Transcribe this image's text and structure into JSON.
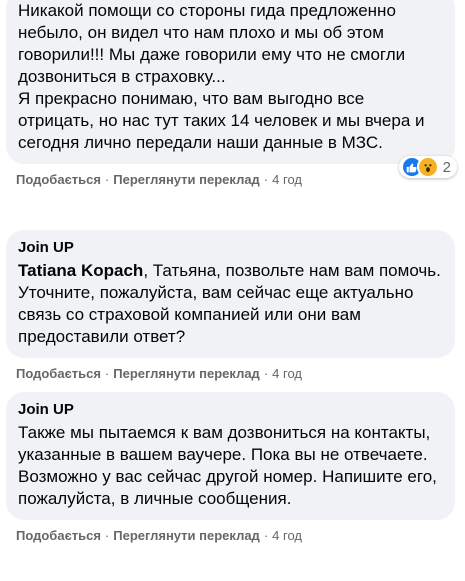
{
  "comments": [
    {
      "author": "",
      "text": "Никакой помощи со стороны гида предложенно небыло, он видел что нам плохо и мы об этом говорили!!! Мы даже говорили ему что не смогли дозвониться в страховку...\nЯ прекрасно понимаю, что вам выгодно все отрицать, но нас тут таких 14 человек и мы вчера и сегодня лично передали наши данные в МЗС.",
      "reactions": {
        "icons": [
          "like-icon",
          "wow-icon"
        ],
        "count": "2"
      },
      "actions": {
        "like": "Подобається",
        "translate": "Переглянути переклад",
        "time": "4 год"
      }
    },
    {
      "author": "Join UP",
      "mention": "Tatiana Kopach",
      "text": ", Татьяна, позвольте нам вам помочь. Уточните, пожалуйста, вам сейчас еще актуально связь со страховой компанией или они вам предоставили ответ?",
      "actions": {
        "like": "Подобається",
        "translate": "Переглянути переклад",
        "time": "4 год"
      }
    },
    {
      "author": "Join UP",
      "text": "Также мы пытаемся к вам дозвониться на контакты, указанные в вашем ваучере. Пока вы не отвечаете. Возможно у вас сейчас другой номер. Напишите его, пожалуйста, в личные сообщения.",
      "actions": {
        "like": "Подобається",
        "translate": "Переглянути переклад",
        "time": "4 год"
      }
    }
  ],
  "colors": {
    "bubble": "#f0f2f5",
    "text": "#050505",
    "meta": "#65676b",
    "like": "#1877f2",
    "wow": "#f7b125"
  }
}
